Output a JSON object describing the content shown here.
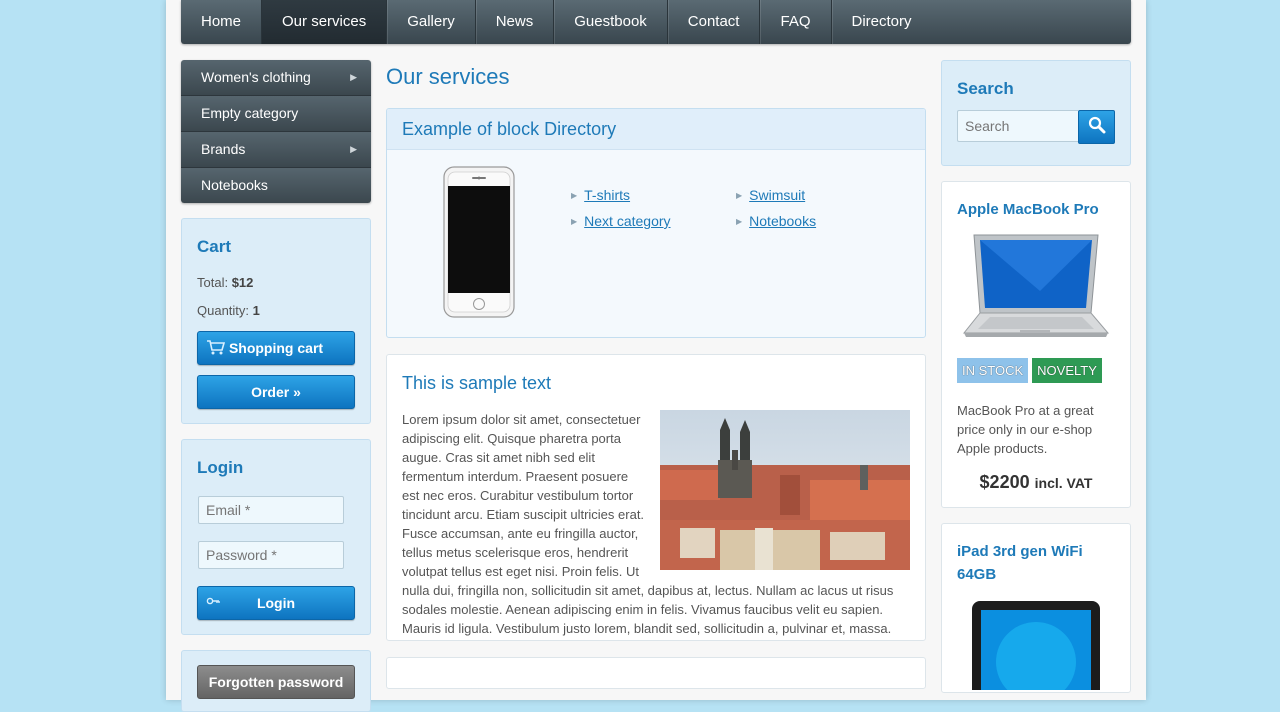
{
  "nav": {
    "items": [
      {
        "label": "Home",
        "active": false
      },
      {
        "label": "Our services",
        "active": true
      },
      {
        "label": "Gallery",
        "active": false
      },
      {
        "label": "News",
        "active": false
      },
      {
        "label": "Guestbook",
        "active": false
      },
      {
        "label": "Contact",
        "active": false
      },
      {
        "label": "FAQ",
        "active": false
      },
      {
        "label": "Directory",
        "active": false
      }
    ]
  },
  "categories": {
    "items": [
      {
        "label": "Women's clothing",
        "has_sub": true
      },
      {
        "label": "Empty category",
        "has_sub": false
      },
      {
        "label": "Brands",
        "has_sub": true
      },
      {
        "label": "Notebooks",
        "has_sub": false
      }
    ]
  },
  "cart": {
    "title": "Cart",
    "total_label": "Total:",
    "total_value": "$12",
    "quantity_label": "Quantity:",
    "quantity_value": "1",
    "shopping_cart_button": "Shopping cart",
    "order_button": "Order »"
  },
  "login": {
    "title": "Login",
    "email_placeholder": "Email *",
    "password_placeholder": "Password *",
    "login_button": "Login",
    "forgotten_button": "Forgotten password"
  },
  "main": {
    "page_title": "Our services",
    "directory_block": {
      "title": "Example of block Directory",
      "links": [
        "T-shirts",
        "Swimsuit",
        "Next category",
        "Notebooks"
      ]
    },
    "sample": {
      "title": "This is sample text",
      "body": "Lorem ipsum dolor sit amet, consectetuer adipiscing elit. Quisque pharetra porta augue. Cras sit amet nibh sed elit fermentum interdum. Praesent posuere est nec eros. Curabitur vestibulum tortor tincidunt arcu. Etiam suscipit ultricies erat. Fusce accumsan, ante eu fringilla auctor, tellus metus scelerisque eros, hendrerit volutpat tellus est eget nisi. Proin felis. Ut nulla dui, fringilla non, sollicitudin sit amet, dapibus at, lectus. Nullam ac lacus ut risus sodales molestie. Aenean adipiscing enim in felis. Vivamus faucibus velit eu sapien. Mauris id ligula. Vestibulum justo lorem, blandit sed, sollicitudin a, pulvinar et, massa."
    }
  },
  "search": {
    "title": "Search",
    "placeholder": "Search"
  },
  "products": [
    {
      "title": "Apple MacBook Pro",
      "badge_stock": "IN STOCK",
      "badge_novelty": "NOVELTY",
      "description": "MacBook Pro at a great price only in our e-shop Apple products.",
      "price": "$2200",
      "price_note": "incl. VAT"
    },
    {
      "title": "iPad 3rd gen WiFi 64GB"
    }
  ],
  "colors": {
    "accent": "#1e7ab8",
    "button_blue": "#1b8ad3",
    "nav_dark": "#3b474e",
    "badge_stock": "#8ec2ea",
    "badge_novelty": "#2e9a54",
    "background": "#b6e2f4"
  }
}
